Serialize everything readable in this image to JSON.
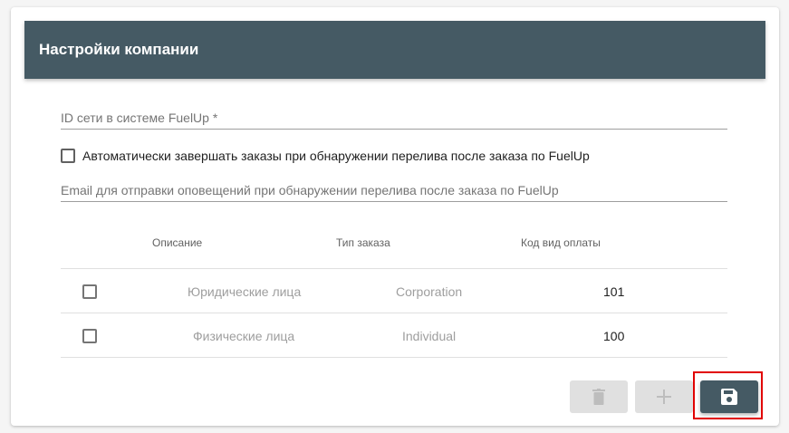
{
  "header": {
    "title": "Настройки компании"
  },
  "form": {
    "network_id_placeholder": "ID сети в системе FuelUp *",
    "auto_complete_label": "Автоматически завершать заказы при обнаружении перелива после заказа по FuelUp",
    "email_placeholder": "Email для отправки оповещений при обнаружении перелива после заказа по FuelUp"
  },
  "table": {
    "headers": [
      "Описание",
      "Тип заказа",
      "Код вид оплаты"
    ],
    "rows": [
      {
        "description": "Юридические лица",
        "type": "Corporation",
        "code": "101"
      },
      {
        "description": "Физические лица",
        "type": "Individual",
        "code": "100"
      }
    ]
  },
  "colors": {
    "header_bg": "#455a64",
    "disabled_button": "#e0e0e0",
    "highlight": "#e10000"
  },
  "icons": [
    "trash-icon",
    "plus-icon",
    "save-icon"
  ]
}
